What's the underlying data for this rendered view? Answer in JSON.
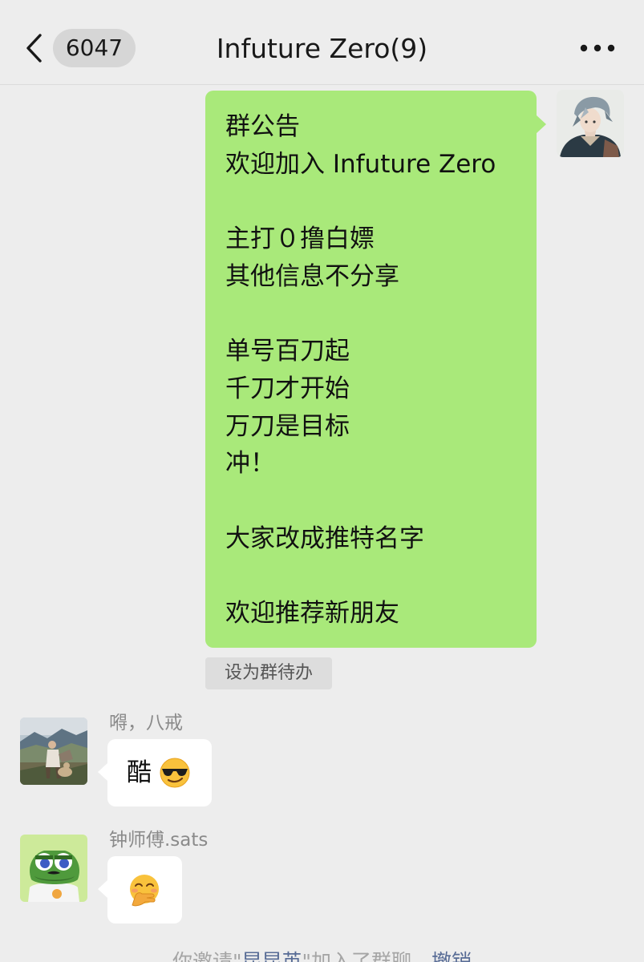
{
  "header": {
    "back_label": "",
    "unread_count": "6047",
    "title": "Infuture Zero(9)"
  },
  "announcement": {
    "lines": [
      "群公告",
      "欢迎加入 Infuture Zero",
      "",
      "主打０撸白嫖",
      "其他信息不分享",
      "",
      "单号百刀起",
      "千刀才开始",
      "万刀是目标",
      "冲！",
      "",
      "大家改成推特名字",
      "",
      "欢迎推荐新朋友"
    ],
    "set_todo_label": "设为群待办"
  },
  "messages": [
    {
      "sender": "嘚，八戒",
      "text": "酷",
      "emoji": "smiling-face-with-sunglasses"
    },
    {
      "sender": "钟师傅.sats",
      "text": "",
      "emoji": "face-with-hand-over-mouth"
    }
  ],
  "system_notice": {
    "prefix": "你邀请\"",
    "name": "昆昆英",
    "middle": "\"加入了群聊",
    "action": "撤销"
  },
  "colors": {
    "own_bubble": "#a9e97a",
    "other_bubble": "#ffffff",
    "background": "#ededed",
    "link": "#576b95"
  }
}
